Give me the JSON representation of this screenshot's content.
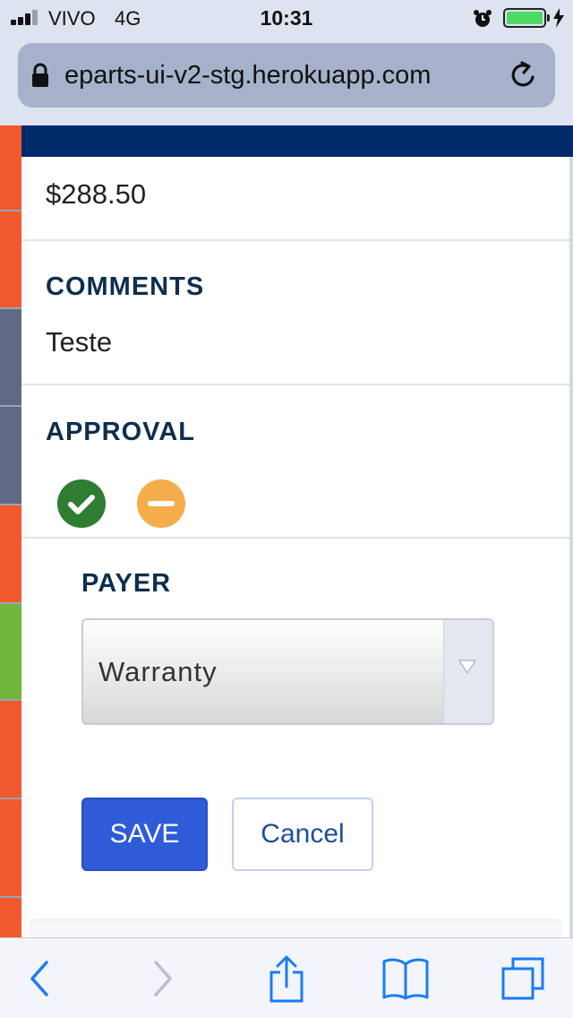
{
  "status_bar": {
    "carrier": "VIVO",
    "network": "4G",
    "time": "10:31",
    "battery_color": "#4cd964"
  },
  "browser": {
    "url": "eparts-ui-v2-stg.herokuapp.com"
  },
  "detail": {
    "amount_value": "$288.50",
    "comments_label": "COMMENTS",
    "comments_value": "Teste",
    "approval_label": "APPROVAL"
  },
  "form": {
    "payer_label": "PAYER",
    "payer_selected": "Warranty",
    "save_label": "SAVE",
    "cancel_label": "Cancel"
  },
  "toolbar": {
    "icons": [
      "back-icon",
      "forward-icon",
      "share-icon",
      "bookmarks-icon",
      "tabs-icon"
    ]
  },
  "colors": {
    "nav_band": "#002a6a",
    "approve": "#2e7d32",
    "neutral": "#f4ad4a",
    "save_button": "#2f5bd8",
    "heading": "#0e2e4f"
  }
}
